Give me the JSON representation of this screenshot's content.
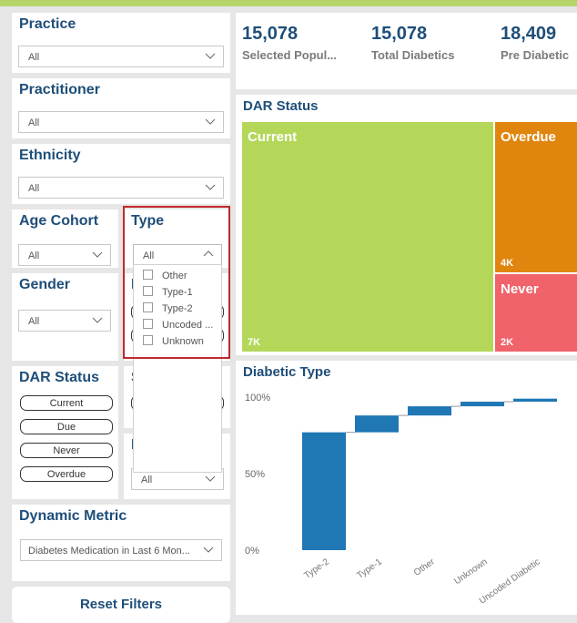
{
  "filters": {
    "practice": {
      "title": "Practice",
      "value": "All"
    },
    "practitioner": {
      "title": "Practitioner",
      "value": "All"
    },
    "ethnicity": {
      "title": "Ethnicity",
      "value": "All"
    },
    "age_cohort": {
      "title": "Age Cohort",
      "value": "All"
    },
    "type": {
      "title": "Type",
      "value": "All",
      "options": [
        "Other",
        "Type-1",
        "Type-2",
        "Uncoded ...",
        "Unknown"
      ]
    },
    "gender": {
      "title": "Gender",
      "value": "All",
      "partial_title": "D"
    },
    "dar_status": {
      "title": "DAR Status",
      "options": [
        "Current",
        "Due",
        "Never",
        "Overdue"
      ]
    },
    "partial_s": {
      "title": "S"
    },
    "partial_h": {
      "title": "H",
      "value": "All"
    },
    "dynamic_metric": {
      "title": "Dynamic Metric",
      "value": "Diabetes Medication in Last 6 Mon..."
    },
    "reset_label": "Reset Filters"
  },
  "kpis": [
    {
      "value": "15,078",
      "label": "Selected Popul..."
    },
    {
      "value": "15,078",
      "label": "Total Diabetics"
    },
    {
      "value": "18,409",
      "label": "Pre Diabetic"
    }
  ],
  "dar_status_chart": {
    "title": "DAR Status",
    "tiles": [
      {
        "name": "Current",
        "value": "7K",
        "color": "#b4d75a"
      },
      {
        "name": "Overdue",
        "value": "4K",
        "color": "#e0860f"
      },
      {
        "name": "Never",
        "value": "2K",
        "color": "#f0636a"
      }
    ]
  },
  "colors": {
    "accent": "#1e4e79",
    "bar": "#1f77b4",
    "highlight_border": "#c0282d"
  },
  "chart_data": {
    "type": "bar",
    "subtype": "waterfall",
    "title": "Diabetic Type",
    "categories": [
      "Type-2",
      "Type-1",
      "Other",
      "Unknown",
      "Uncoded Diabetic"
    ],
    "values": [
      77,
      11,
      6,
      3,
      2
    ],
    "yticks": [
      "100%",
      "50%",
      "0%"
    ],
    "ylim": [
      0,
      100
    ],
    "ylabel": "",
    "xlabel": ""
  }
}
